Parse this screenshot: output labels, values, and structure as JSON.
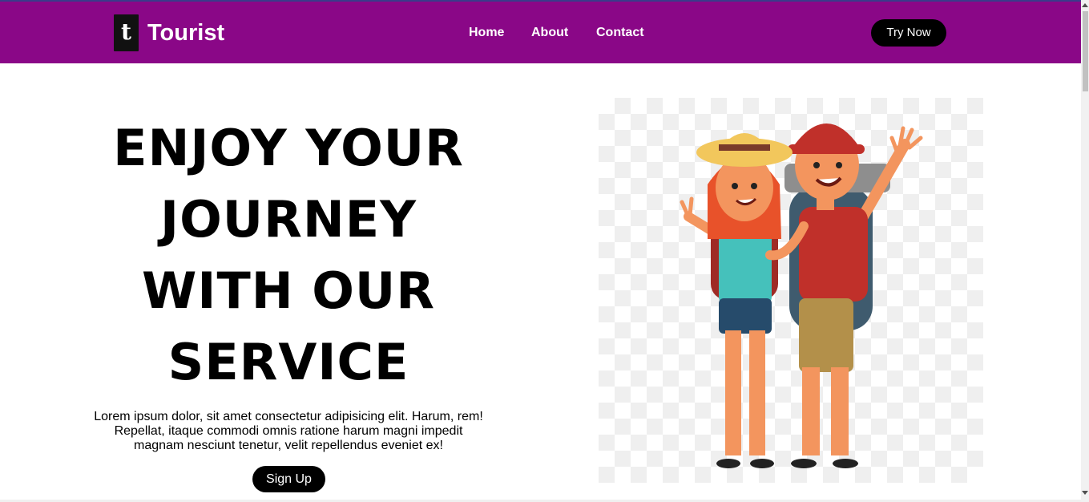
{
  "navbar": {
    "logo_letter": "t",
    "brand": "Tourist",
    "links": [
      "Home",
      "About",
      "Contact"
    ],
    "cta_label": "Try Now",
    "background_color": "#8a0787"
  },
  "hero": {
    "title_lines": [
      "ENJOY YOUR",
      "JOURNEY",
      "WITH OUR",
      "SERVICE"
    ],
    "description": "Lorem ipsum dolor, sit amet consectetur adipisicing elit. Harum, rem! Repellat, itaque commodi omnis ratione harum magni impedit magnam nesciunt tenetur, velit repellendus eveniet ex!",
    "button_label": "Sign Up",
    "image_icon": "tourist-couple-illustration"
  }
}
